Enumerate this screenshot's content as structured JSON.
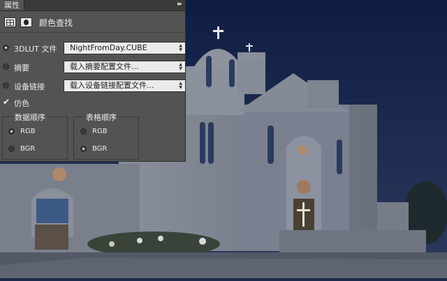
{
  "panel": {
    "tab_label": "属性",
    "collapse_glyph": "▸▸",
    "title": "颜色查找",
    "lut3d": {
      "label": "3DLUT 文件",
      "value": "NightFromDay.CUBE",
      "selected": true
    },
    "abstract": {
      "label": "摘要",
      "value": "载入摘要配置文件...",
      "selected": false
    },
    "device_link": {
      "label": "设备链接",
      "value": "载入设备链接配置文件...",
      "selected": false
    },
    "dither": {
      "label": "仿色",
      "checked": true
    },
    "data_order": {
      "title": "数据顺序",
      "options": [
        "RGB",
        "BGR"
      ],
      "selected": "RGB"
    },
    "table_order": {
      "title": "表格顺序",
      "options": [
        "RGB",
        "BGR"
      ],
      "selected": "BGR"
    }
  },
  "icons": {
    "grid": "grid-icon",
    "mask": "mask-icon",
    "checkmark": "checkmark-icon"
  },
  "colors": {
    "panel_bg": "#535353",
    "sky": "#14224a",
    "stone": "#6e7382"
  }
}
